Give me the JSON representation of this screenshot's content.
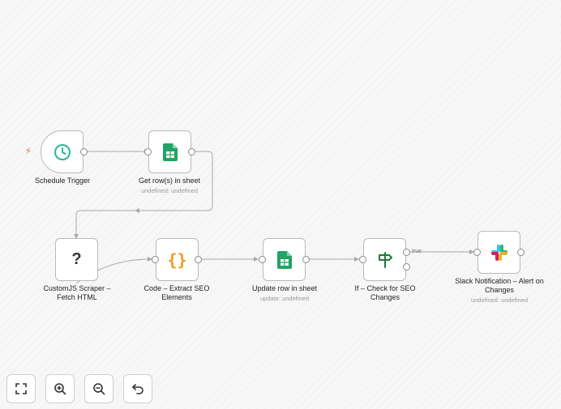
{
  "nodes": {
    "schedule_trigger": {
      "label": "Schedule Trigger",
      "icon": "clock-icon",
      "color": "#2bb59a"
    },
    "get_rows": {
      "label": "Get row(s) in sheet",
      "subtitle": "undefined: undefined",
      "icon": "google-sheets-icon",
      "color": "#21a464"
    },
    "custom_js": {
      "label": "CustomJS Scraper – Fetch HTML",
      "icon": "question-mark-icon",
      "glyph": "?"
    },
    "code": {
      "label": "Code – Extract SEO Elements",
      "icon": "code-braces-icon",
      "glyph": "{}",
      "color": "#f29a1f"
    },
    "update_row": {
      "label": "Update row in sheet",
      "subtitle": "update: undefined",
      "icon": "google-sheets-icon",
      "color": "#21a464"
    },
    "if_check": {
      "label": "If – Check for SEO Changes",
      "icon": "signpost-icon",
      "color": "#1d7a3e"
    },
    "slack": {
      "label": "Slack Notification – Alert on Changes",
      "subtitle": "undefined: undefined",
      "icon": "slack-icon"
    }
  },
  "edges": {
    "true_label": "true"
  },
  "controls": [
    {
      "name": "fit-view-button",
      "icon": "fullscreen-icon"
    },
    {
      "name": "zoom-in-button",
      "icon": "zoom-in-icon"
    },
    {
      "name": "zoom-out-button",
      "icon": "zoom-out-icon"
    },
    {
      "name": "undo-button",
      "icon": "undo-icon"
    }
  ]
}
